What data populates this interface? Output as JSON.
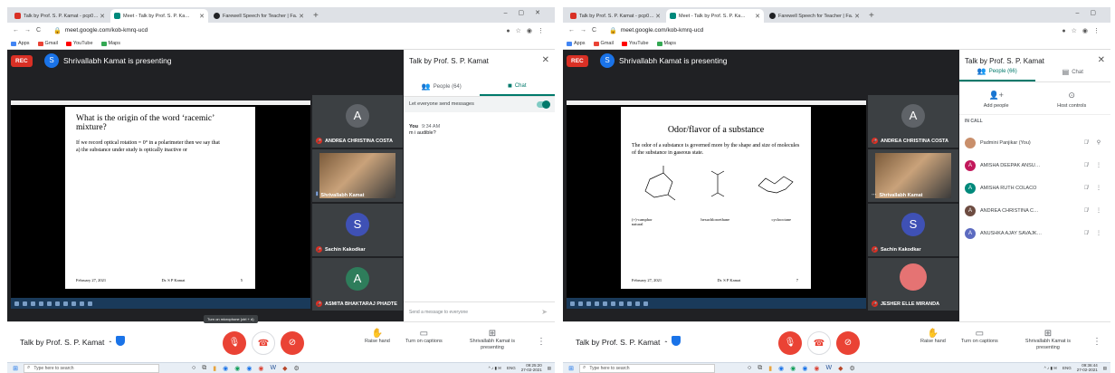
{
  "screens": [
    {
      "browser": {
        "tabs": [
          {
            "label": "Talk by Prof. S. P. Kamat - pcp0…",
            "color": "#d93025",
            "active": false
          },
          {
            "label": "Meet - Talk by Prof. S. P. Ka…",
            "color": "#00897b",
            "active": true
          },
          {
            "label": "Farewell Speech for Teacher | Fa…",
            "color": "#202124",
            "active": false
          }
        ],
        "url": "meet.google.com/kob-kmrq-ucd",
        "bookmarks": [
          "Apps",
          "Gmail",
          "YouTube",
          "Maps"
        ]
      },
      "meeting": {
        "rec_label": "REC",
        "presenter_initial": "S",
        "presenting_text": "Shrivallabh Kamat is presenting",
        "meeting_title": "Talk by Prof. S. P. Kamat",
        "tooltip": "Turn on microphone (ctrl + d)",
        "raise_hand": "Raise hand",
        "captions": "Turn on captions",
        "presenter_btn": "Shrivallabh Kamat is presenting"
      },
      "slide": {
        "title": "What is the origin of the word ‘racemic’ mixture?",
        "body": "If we record optical rotation = 0° in a polarimeter then we say that\na) the substance under study is optically inactive  or",
        "date": "February 27, 2021",
        "author": "Dr. S P Kamat",
        "page": "5"
      },
      "tiles": [
        {
          "initial": "A",
          "name": "ANDREA CHRISTINA COSTA",
          "color": "#5f6368"
        },
        {
          "initial": "",
          "name": "Shrivallabh Kamat",
          "color": "#5f6368"
        },
        {
          "initial": "S",
          "name": "Sachin Kakodkar",
          "color": "#3f51b5"
        },
        {
          "initial": "A",
          "name": "ASMITA BHAKTARAJ PHADTE",
          "color": "#2e7d5b"
        }
      ],
      "side": {
        "title": "Talk by Prof. S. P. Kamat",
        "people_tab": "People (64)",
        "chat_tab": "Chat",
        "toggle_label": "Let everyone send messages",
        "msg_sender": "You",
        "msg_time": "9:34 AM",
        "msg_text": "m i audible?",
        "send_placeholder": "Send a message to everyone"
      },
      "taskbar": {
        "search": "Type here to search",
        "time": "09:25:20",
        "date": "27-02-2021",
        "lang": "ENG"
      }
    },
    {
      "browser": {
        "tabs": [
          {
            "label": "Talk by Prof. S. P. Kamat - pcp0…",
            "color": "#d93025",
            "active": false
          },
          {
            "label": "Meet - Talk by Prof. S. P. Ka…",
            "color": "#00897b",
            "active": true
          },
          {
            "label": "Farewell Speech for Teacher | Fa…",
            "color": "#202124",
            "active": false
          }
        ],
        "url": "meet.google.com/kob-kmrq-ucd",
        "bookmarks": [
          "Apps",
          "Gmail",
          "YouTube",
          "Maps"
        ]
      },
      "meeting": {
        "rec_label": "REC",
        "presenter_initial": "S",
        "presenting_text": "Shrivallabh Kamat is presenting",
        "meeting_title": "Talk by Prof. S. P. Kamat",
        "tooltip": "",
        "raise_hand": "Raise hand",
        "captions": "Turn on captions",
        "presenter_btn": "Shrivallabh Kamat is presenting"
      },
      "slide": {
        "title": "Odor/flavor of a substance",
        "body": "The odor of a substance is governed more by the shape and size of molecules of the substance in gaseous state.",
        "labels": [
          "(+)-camphor natural",
          "hexachloroethane",
          "cyclooctane"
        ],
        "date": "February 27, 2021",
        "author": "Dr. S P Kamat",
        "page": "7"
      },
      "tiles": [
        {
          "initial": "A",
          "name": "ANDREA CHRISTINA COSTA",
          "color": "#5f6368"
        },
        {
          "initial": "",
          "name": "Shrivallabh Kamat",
          "color": "#5f6368"
        },
        {
          "initial": "S",
          "name": "Sachin Kakodkar",
          "color": "#3f51b5"
        },
        {
          "initial": "",
          "name": "JESHER ELLE MIRANDA",
          "color": "#5f6368"
        }
      ],
      "side": {
        "title": "Talk by Prof. S. P. Kamat",
        "people_tab": "People (66)",
        "chat_tab": "Chat",
        "add_people": "Add people",
        "host_controls": "Host controls",
        "in_call": "IN CALL",
        "people": [
          {
            "initial": "",
            "name": "Padmini Panjikar (You)",
            "color": "#c98f6b"
          },
          {
            "initial": "A",
            "name": "AMISHA DEEPAK ANSU…",
            "color": "#c2185b"
          },
          {
            "initial": "A",
            "name": "AMISHA RUTH COLACO",
            "color": "#00897b"
          },
          {
            "initial": "A",
            "name": "ANDREA CHRISTINA C…",
            "color": "#6d4c41"
          },
          {
            "initial": "A",
            "name": "ANUSHKA AJAY SAVAJK…",
            "color": "#5c6bc0"
          }
        ]
      },
      "taskbar": {
        "search": "Type here to search",
        "time": "09:36:44",
        "date": "27-02-2021",
        "lang": "ENG"
      }
    }
  ]
}
